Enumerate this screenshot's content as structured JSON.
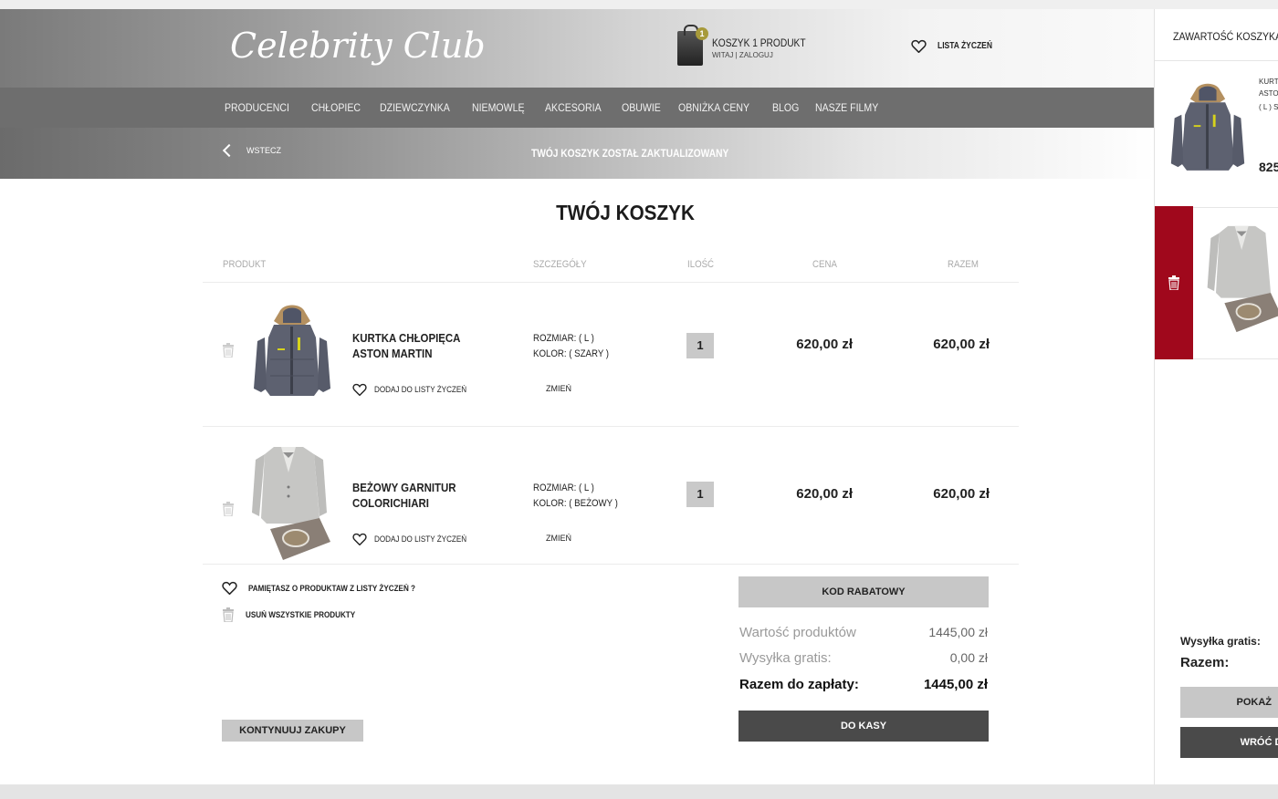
{
  "header": {
    "logo": "Celebrity Club",
    "cart_title": "KOSZYK 1 PRODUKT",
    "cart_sub": "WITAJ | ZALOGUJ",
    "cart_badge": "1",
    "wishlist_label": "LISTA ŻYCZEŃ"
  },
  "nav": {
    "items": [
      "PRODUCENCI",
      "CHŁOPIEC",
      "DZIEWCZYNKA",
      "NIEMOWLĘ",
      "AKCESORIA",
      "OBUWIE",
      "OBNIŻKA CENY",
      "BLOG",
      "NASZE FILMY"
    ]
  },
  "subbar": {
    "back_label": "WSTECZ",
    "notice": "TWÓJ KOSZYK ZOSTAŁ ZAKTUALIZOWANY"
  },
  "cart": {
    "title": "TWÓJ KOSZYK",
    "columns": {
      "product": "PRODUKT",
      "details": "SZCZEGÓŁY",
      "qty": "ILOŚĆ",
      "price": "CENA",
      "total": "RAZEM"
    },
    "items": [
      {
        "name_line1": "KURTKA CHŁOPIĘCA",
        "name_line2": "ASTON MARTIN",
        "add_wish": "DODAJ DO LISTY ŻYCZEŃ",
        "size": "ROZMIAR:     ( L )",
        "color": "KOLOR:    ( SZARY )",
        "change": "ZMIEŃ",
        "qty": "1",
        "price": "620,00 zł",
        "total": "620,00 zł"
      },
      {
        "name_line1": "BEŻOWY GARNITUR",
        "name_line2": "COLORICHIARI",
        "add_wish": "DODAJ DO LISTY ŻYCZEŃ",
        "size": "ROZMIAR:     ( L )",
        "color": "KOLOR:    ( BEŻOWY )",
        "change": "ZMIEŃ",
        "qty": "1",
        "price": "620,00 zł",
        "total": "620,00 zł"
      }
    ],
    "remember_wish": "PAMIĘTASZ O PRODUKTAW Z LISTY ŻYCZEŃ ?",
    "remove_all": "USUŃ WSZYSTKIE PRODUKTY",
    "continue": "KONTYNUUJ ZAKUPY",
    "discount": "KOD RABATOWY",
    "checkout": "DO KASY",
    "summary": {
      "products_label": "Wartość produktów",
      "products_value": "1445,00 zł",
      "shipping_label": "Wysyłka gratis:",
      "shipping_value": "0,00 zł",
      "total_label": "Razem do zapłaty:",
      "total_value": "1445,00 zł"
    }
  },
  "panel": {
    "title": "ZAWARTOŚĆ KOSZYKA",
    "item1_line1": "KURT",
    "item1_line2": "ASTO",
    "item1_line3": "( L ) S",
    "item1_price": "825",
    "shipping": "Wysyłka gratis:",
    "total": "Razem:",
    "btn_show": "POKAŻ",
    "btn_back": "WRÓĆ DO"
  }
}
